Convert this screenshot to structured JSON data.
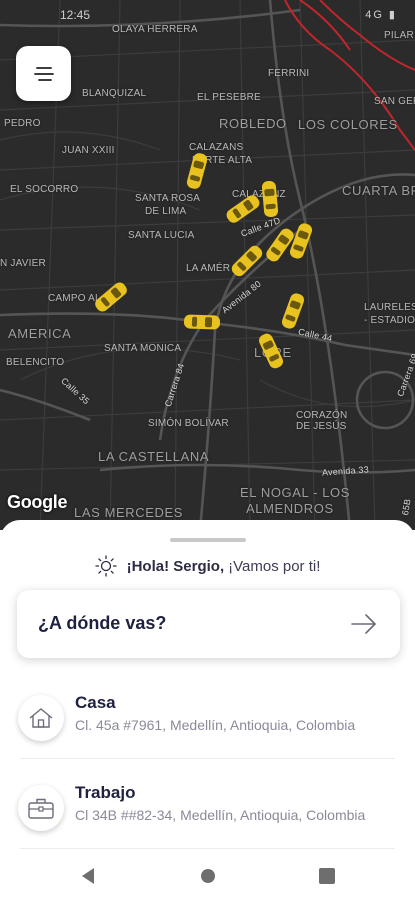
{
  "status_bar": {
    "time": "12:45",
    "icons": "4G ▮"
  },
  "map": {
    "labels": {
      "olaya_herrera": "OLAYA HERRERA",
      "pilar": "PILAR",
      "ferrini": "FERRINI",
      "blanquizal": "BLANQUIZAL",
      "el_pesebre": "EL PESEBRE",
      "san_germ": "SAN GER",
      "pedro": "PEDRO",
      "robledo": "ROBLEDO",
      "los_colores": "LOS COLORES",
      "juan_xxiii": "JUAN XXIII",
      "calazans": "CALAZANS",
      "parte_alta": "PARTE ALTA",
      "el_socorro": "EL SOCORRO",
      "cuarta_br": "CUARTA BR",
      "santa_rosa": "SANTA ROSA",
      "de_lima": "DE LIMA",
      "calazans2": "CALAZANZ",
      "santa_lucia": "SANTA LUCIA",
      "calle_47d": "Calle 47D",
      "san_javier": "N JAVIER",
      "la_america": "LA AMÉR",
      "avenida_80": "Avenida 80",
      "campo_alegre": "CAMPO AL",
      "laureles": "LAURELES",
      "estadio": "- ESTADIO",
      "america": "AMERICA",
      "calle_44": "Calle 44",
      "belencito": "BELENCITO",
      "santa_monica": "SANTA MONICA",
      "lorena": "LORE",
      "carrera_69": "Carrera 69",
      "calle_35": "Calle 35",
      "carrera_84": "Carrera 84",
      "corazon": "CORAZÓN",
      "de_jesus": "DE JESÚS",
      "simon_bolivar": "SIMÓN BOLÍVAR",
      "la_castellana": "LA CASTELLANA",
      "avenida_33": "Avenida 33",
      "el_nogal": "EL NOGAL - LOS",
      "almendros": "ALMENDROS",
      "las_mercedes": "LAS MERCEDES",
      "carrera_65b": "65B"
    },
    "google_logo": "Google"
  },
  "menu": {
    "icon": "menu-icon"
  },
  "greeting": {
    "name": "¡Hola! Sergio,",
    "rest": "¡Vamos por ti!"
  },
  "search": {
    "label": "¿A dónde vas?"
  },
  "places": [
    {
      "title": "Casa",
      "address": "Cl. 45a #7961, Medellín, Antioquia, Colombia",
      "icon": "home-icon"
    },
    {
      "title": "Trabajo",
      "address": "Cl 34B ##82-34, Medellín, Antioquia, Colombia",
      "icon": "briefcase-icon"
    }
  ],
  "colors": {
    "map_bg": "#2b2b2b",
    "taxi": "#e8c21f",
    "text_primary": "#1f2140",
    "rail": "#c0262b"
  }
}
